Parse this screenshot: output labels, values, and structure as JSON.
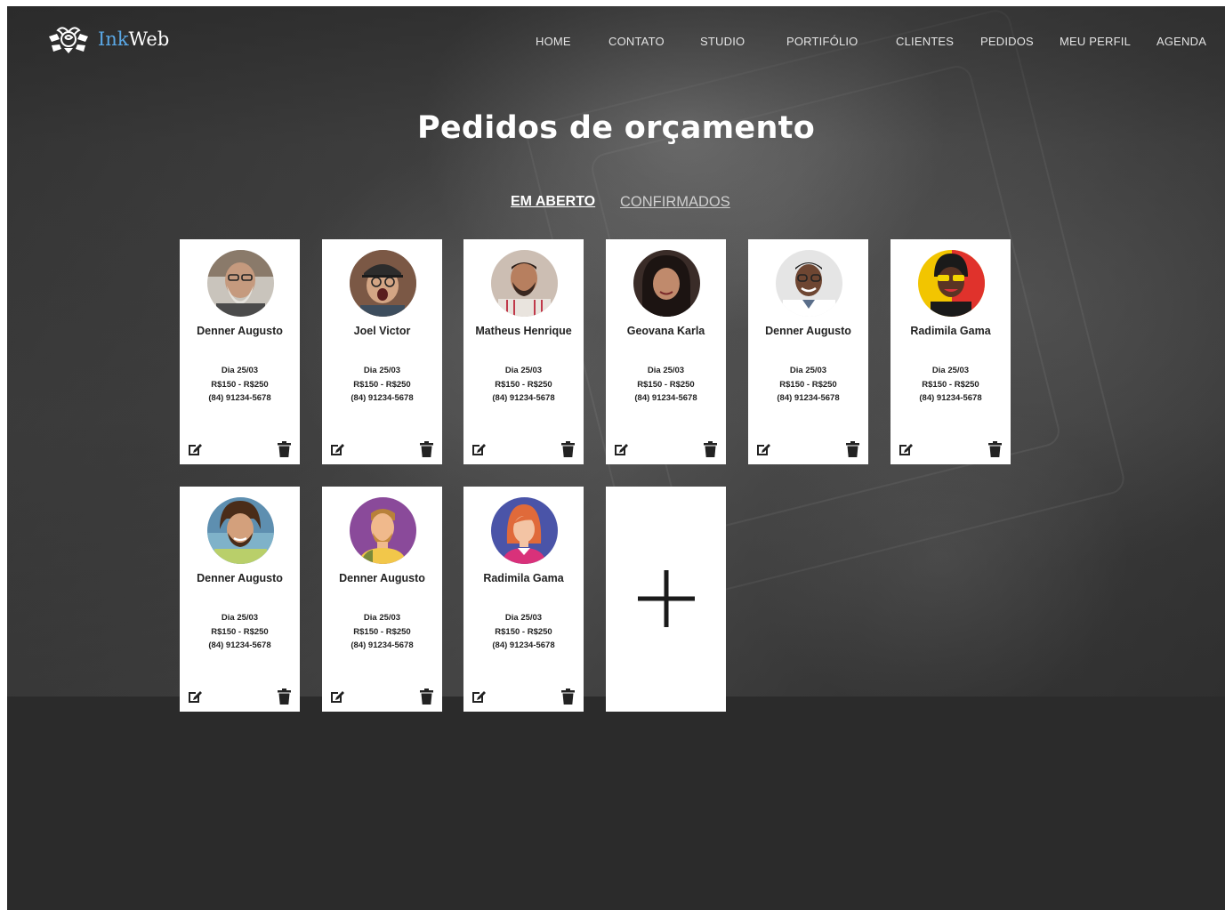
{
  "brand": {
    "name_part1": "Ink",
    "name_part2": "Web"
  },
  "nav": [
    {
      "label": "HOME"
    },
    {
      "label": "CONTATO"
    },
    {
      "label": "STUDIO"
    },
    {
      "label": "PORTIFÓLIO"
    },
    {
      "label": "CLIENTES"
    },
    {
      "label": "PEDIDOS"
    },
    {
      "label": "MEU PERFIL"
    },
    {
      "label": "AGENDA"
    }
  ],
  "page": {
    "title": "Pedidos de orçamento"
  },
  "tabs": [
    {
      "label": "EM ABERTO",
      "active": true
    },
    {
      "label": "CONFIRMADOS",
      "active": false
    }
  ],
  "cards": [
    {
      "name": "Denner Augusto",
      "date": "Dia 25/03",
      "price": "R$150 - R$250",
      "phone": "(84) 91234-5678"
    },
    {
      "name": "Joel Victor",
      "date": "Dia 25/03",
      "price": "R$150 - R$250",
      "phone": "(84) 91234-5678"
    },
    {
      "name": "Matheus Henrique",
      "date": "Dia 25/03",
      "price": "R$150 - R$250",
      "phone": "(84) 91234-5678"
    },
    {
      "name": "Geovana Karla",
      "date": "Dia 25/03",
      "price": "R$150 - R$250",
      "phone": "(84) 91234-5678"
    },
    {
      "name": "Denner Augusto",
      "date": "Dia 25/03",
      "price": "R$150 - R$250",
      "phone": "(84) 91234-5678"
    },
    {
      "name": "Radimila Gama",
      "date": "Dia 25/03",
      "price": "R$150 - R$250",
      "phone": "(84) 91234-5678"
    },
    {
      "name": "Denner Augusto",
      "date": "Dia 25/03",
      "price": "R$150 - R$250",
      "phone": "(84) 91234-5678"
    },
    {
      "name": "Denner Augusto",
      "date": "Dia 25/03",
      "price": "R$150 - R$250",
      "phone": "(84) 91234-5678"
    },
    {
      "name": "Radimila Gama",
      "date": "Dia 25/03",
      "price": "R$150 - R$250",
      "phone": "(84) 91234-5678"
    }
  ],
  "icons": {
    "edit": "edit-icon",
    "delete": "trash-icon",
    "add": "plus-icon"
  },
  "colors": {
    "brand_accent": "#5aa8e6",
    "background": "#2b2b2b",
    "card": "#ffffff",
    "text": "#222222"
  }
}
